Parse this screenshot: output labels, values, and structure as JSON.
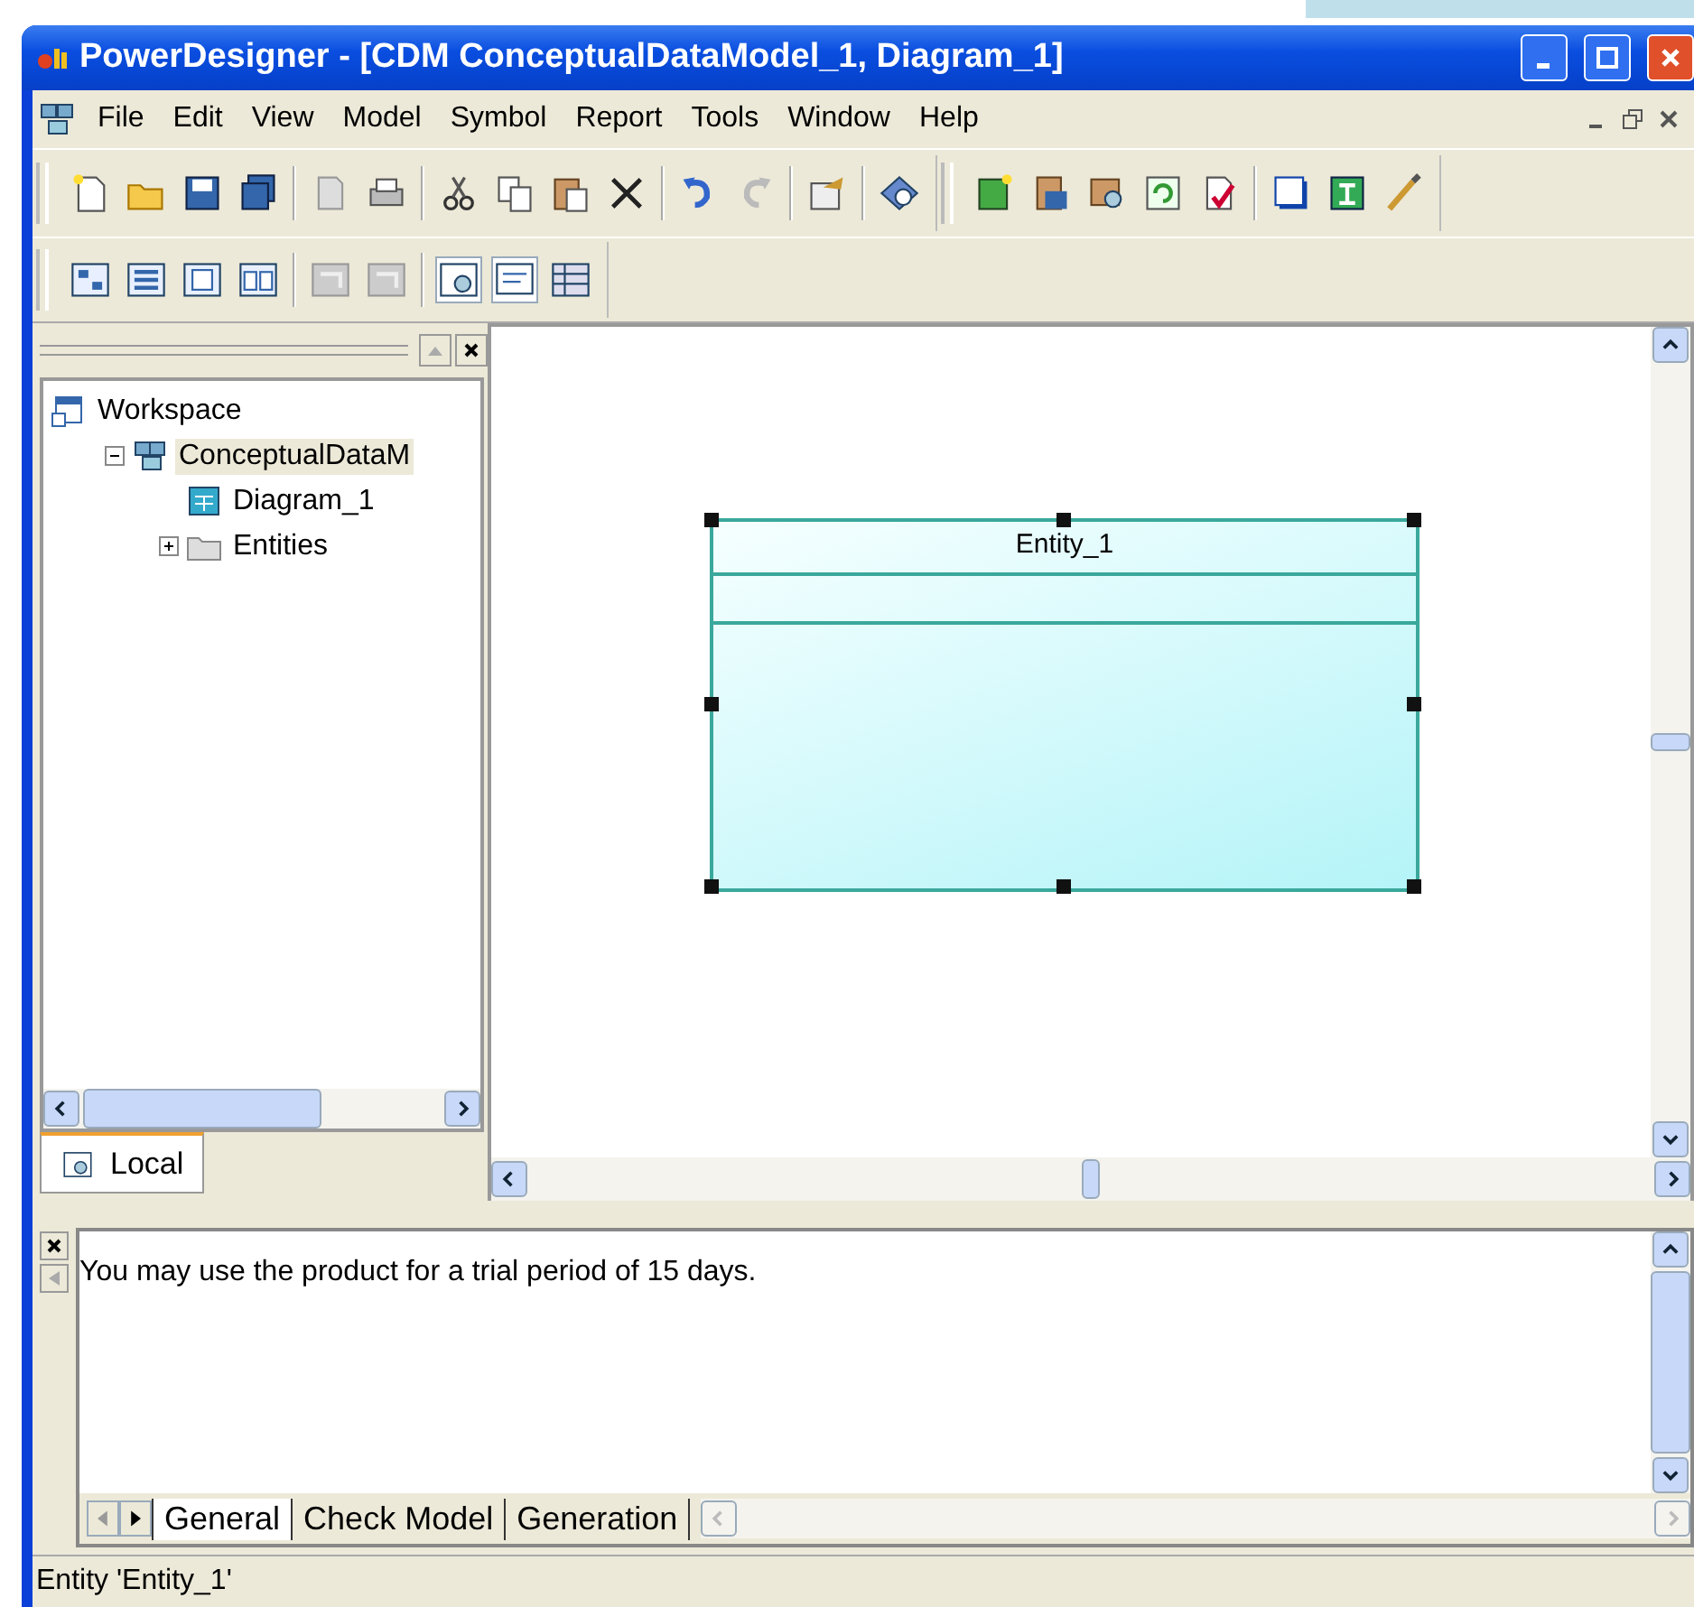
{
  "window": {
    "title": "PowerDesigner - [CDM ConceptualDataModel_1, Diagram_1]"
  },
  "menu": [
    {
      "label": "File"
    },
    {
      "label": "Edit"
    },
    {
      "label": "View"
    },
    {
      "label": "Model"
    },
    {
      "label": "Symbol"
    },
    {
      "label": "Report"
    },
    {
      "label": "Tools"
    },
    {
      "label": "Window"
    },
    {
      "label": "Help"
    }
  ],
  "browser": {
    "tree": [
      {
        "label": "Workspace",
        "selected": false,
        "children": [
          {
            "label": "ConceptualDataM",
            "selected": true,
            "expanded": true,
            "children": [
              {
                "label": "Diagram_1",
                "selected": false
              },
              {
                "label": "Entities",
                "selected": false,
                "expanded": false
              }
            ]
          }
        ]
      }
    ],
    "tabs": [
      {
        "label": "Local",
        "selected": true
      }
    ]
  },
  "diagram": {
    "entities": [
      {
        "name": "Entity_1",
        "selected": true
      }
    ]
  },
  "output": {
    "message": "You may use the product for a trial period of 15 days.",
    "tabs": [
      {
        "label": "General",
        "selected": true
      },
      {
        "label": "Check Model",
        "selected": false
      },
      {
        "label": "Generation",
        "selected": false
      }
    ]
  },
  "status_bar": {
    "text": "Entity 'Entity_1'"
  }
}
